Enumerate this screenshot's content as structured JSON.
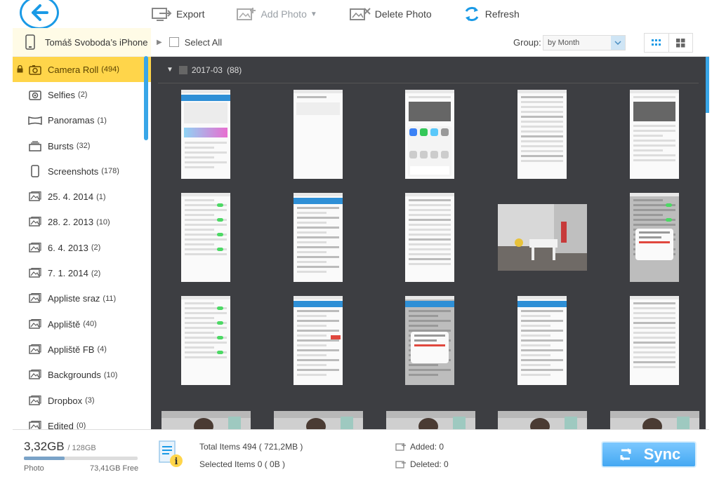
{
  "toolbar": {
    "export_label": "Export",
    "add_photo_label": "Add Photo",
    "delete_photo_label": "Delete Photo",
    "refresh_label": "Refresh"
  },
  "device": {
    "name": "Tomáš Svoboda’s iPhone"
  },
  "header": {
    "select_all_label": "Select All",
    "group_label": "Group:",
    "group_value": "by Month"
  },
  "sidebar": {
    "items": [
      {
        "label": "Camera Roll",
        "count": "(494)",
        "icon": "camera-icon",
        "active": true
      },
      {
        "label": "Selfies",
        "count": "(2)",
        "icon": "selfie-icon"
      },
      {
        "label": "Panoramas",
        "count": "(1)",
        "icon": "panorama-icon"
      },
      {
        "label": "Bursts",
        "count": "(32)",
        "icon": "bursts-icon"
      },
      {
        "label": "Screenshots",
        "count": "(178)",
        "icon": "screenshots-icon"
      },
      {
        "label": "25. 4. 2014",
        "count": "(1)",
        "icon": "album-icon"
      },
      {
        "label": "28. 2. 2013",
        "count": "(10)",
        "icon": "album-icon"
      },
      {
        "label": "6. 4. 2013",
        "count": "(2)",
        "icon": "album-icon"
      },
      {
        "label": "7. 1. 2014",
        "count": "(2)",
        "icon": "album-icon"
      },
      {
        "label": "Appliste sraz",
        "count": "(11)",
        "icon": "album-icon"
      },
      {
        "label": "Appliště",
        "count": "(40)",
        "icon": "album-icon"
      },
      {
        "label": "Appliště FB",
        "count": "(4)",
        "icon": "album-icon"
      },
      {
        "label": "Backgrounds",
        "count": "(10)",
        "icon": "album-icon"
      },
      {
        "label": "Dropbox",
        "count": "(3)",
        "icon": "album-icon"
      },
      {
        "label": "Edited",
        "count": "(0)",
        "icon": "album-icon"
      }
    ]
  },
  "gallery": {
    "group_title": "2017-03",
    "group_count": "(88)"
  },
  "footer": {
    "storage_used": "3,32GB",
    "storage_total": "/ 128GB",
    "storage_fraction": 0.36,
    "storage_type": "Photo",
    "storage_free": "73,41GB Free",
    "total_items": "Total Items  494  ( 721,2MB )",
    "selected_items": "Selected Items  0  ( 0B )",
    "added": "Added:  0",
    "deleted": "Deleted:  0",
    "sync_label": "Sync"
  },
  "colors": {
    "accent": "#1a9ae6",
    "active_album": "#ffd54a",
    "gallery_bg": "#3d3e42",
    "sync": "#44a8f2"
  }
}
